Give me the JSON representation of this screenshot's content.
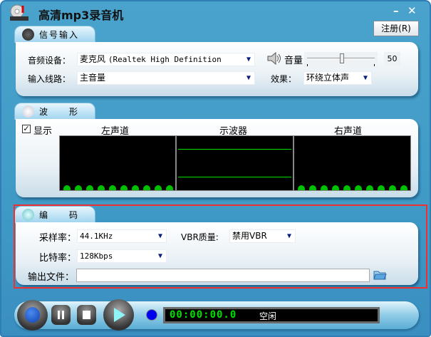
{
  "window": {
    "title": "高清mp3录音机",
    "minimize": "–",
    "close": "✕",
    "register_label": "注册(R)"
  },
  "signal": {
    "tab": "信号输入",
    "device_label": "音频设备：",
    "device_value_cn": "麦克风 ",
    "device_value": "(Realtek High Definition",
    "line_label": "输入线路：",
    "line_value": "主音量",
    "volume_label": "音量",
    "volume_value": "50",
    "volume_level": 50,
    "effect_label": "效果：",
    "effect_value": "环绕立体声"
  },
  "wave": {
    "tab": "波　　形",
    "show_label": "显示",
    "show_checked": true,
    "left_label": "左声道",
    "scope_label": "示波器",
    "right_label": "右声道",
    "accent": "#00c000"
  },
  "encode": {
    "tab": "编　　码",
    "rate_label": "采样率：",
    "rate_value": "44.1KHz",
    "vbr_label": "VBR质量:",
    "vbr_value": "禁用VBR",
    "bitrate_label": "比特率：",
    "bitrate_value": "128Kbps",
    "output_label": "输出文件：",
    "output_value": ""
  },
  "transport": {
    "timer": "00:00:00.0",
    "status": "空闲"
  }
}
